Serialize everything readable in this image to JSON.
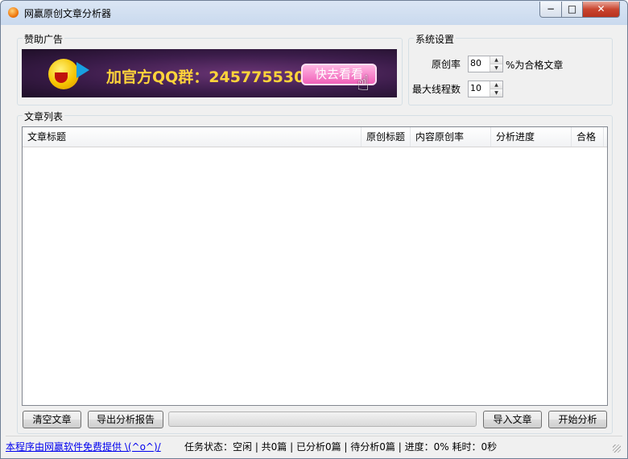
{
  "window": {
    "title": "网赢原创文章分析器",
    "min_glyph": "−",
    "max_glyph": "□",
    "close_glyph": "✕"
  },
  "ad": {
    "group_label": "赞助广告",
    "text": "加官方QQ群：245775530",
    "button": "快去看看"
  },
  "settings": {
    "group_label": "系统设置",
    "rate_label": "原创率",
    "rate_value": "80",
    "rate_suffix": "%为合格文章",
    "threads_label": "最大线程数",
    "threads_value": "10"
  },
  "list": {
    "group_label": "文章列表",
    "columns": [
      "文章标题",
      "原创标题",
      "内容原创率",
      "分析进度",
      "合格"
    ],
    "rows": []
  },
  "buttons": {
    "clear": "清空文章",
    "export": "导出分析报告",
    "import": "导入文章",
    "start": "开始分析"
  },
  "progress": {
    "percent": 0
  },
  "statusbar": {
    "credit": "本程序由网赢软件免费提供 \\(^o^)/",
    "status": "任务状态：空闲 | 共0篇 | 已分析0篇 | 待分析0篇 | 进度：0%    耗时：0秒"
  },
  "colors": {
    "banner_text": "#ffd43a",
    "banner_button": "#f060b8",
    "link": "#0000ee"
  }
}
